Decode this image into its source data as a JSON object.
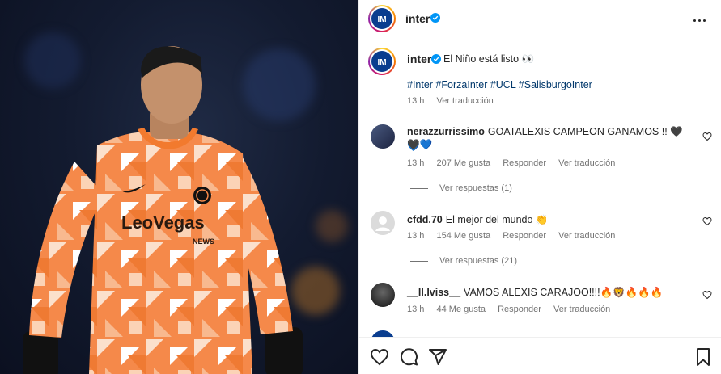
{
  "post": {
    "account": "inter",
    "caption": "El Niño está listo 👀",
    "hashtags": "#Inter #ForzaInter #UCL #SalisburgoInter",
    "time": "13 h",
    "translate": "Ver traducción"
  },
  "comments": [
    {
      "user": "nerazzurrissimo",
      "text_line1": "GOATALEXIS CAMPEON GANAMOS !! 🖤💙",
      "text_line2": "🖤💙",
      "time": "13 h",
      "likes": "207 Me gusta",
      "reply": "Responder",
      "translate": "Ver traducción",
      "replies": "Ver respuestas (1)"
    },
    {
      "user": "cfdd.70",
      "text_line1": "El mejor del mundo 👏",
      "time": "13 h",
      "likes": "154 Me gusta",
      "reply": "Responder",
      "translate": "Ver traducción",
      "replies": "Ver respuestas (21)"
    },
    {
      "user": "__ll.lviss__",
      "text_line1": "VAMOS ALEXIS CARAJOO!!!!🔥🦁🔥🔥🔥",
      "time": "13 h",
      "likes": "44 Me gusta",
      "reply": "Responder",
      "translate": "Ver traducción"
    }
  ],
  "photo": {
    "shirt_sponsor": "LeoVegas",
    "shirt_sponsor_sub": "NEWS"
  },
  "colors": {
    "inter_blue": "#0a3d8f",
    "verified": "#0095f6",
    "link": "#00376b",
    "shirt_orange": "#f5894a"
  },
  "icons": [
    "heart-icon",
    "comment-icon",
    "share-icon",
    "bookmark-icon",
    "more-icon",
    "verified-icon"
  ]
}
